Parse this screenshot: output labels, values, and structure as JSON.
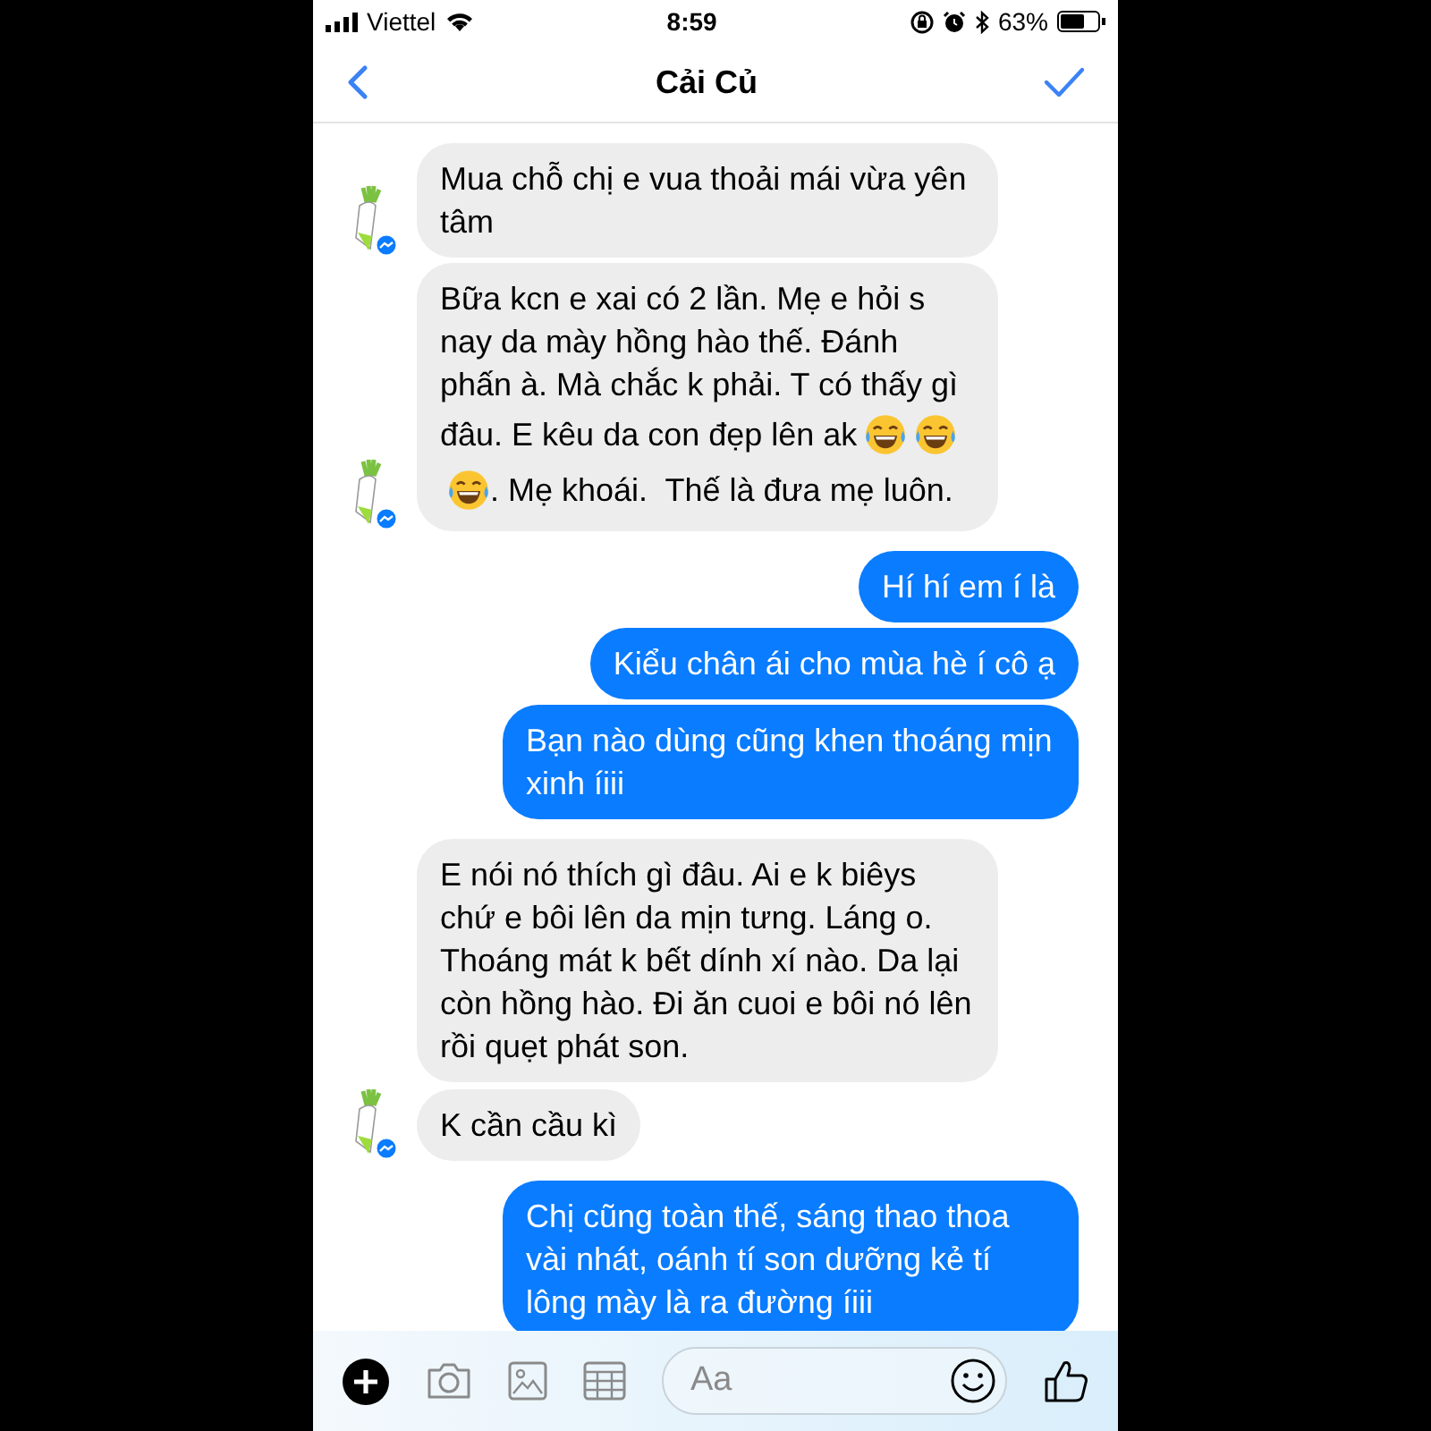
{
  "status_bar": {
    "carrier": "Viettel",
    "time": "8:59",
    "battery": "63%"
  },
  "header": {
    "title": "Cải Củ"
  },
  "messages": [
    {
      "kind": "incoming",
      "show_avatar": true,
      "segments": [
        {
          "kind": "text",
          "text": "Mua chỗ chị e vua thoải mái vừa yên tâm"
        }
      ]
    },
    {
      "kind": "incoming",
      "show_avatar": true,
      "segments": [
        {
          "kind": "text",
          "text": "Bữa kcn e xai có 2 lần. Mẹ e hỏi s nay da mày hồng hào thế. Đánh phấn à. Mà chắc k phải. T có thấy gì"
        },
        {
          "kind": "break"
        },
        {
          "kind": "text",
          "text": "đâu. E kêu da con đẹp lên ak"
        },
        {
          "kind": "emoji"
        },
        {
          "kind": "emoji"
        },
        {
          "kind": "break"
        },
        {
          "kind": "emoji"
        },
        {
          "kind": "text",
          "text": ". Mẹ khoái.  Thế là đưa mẹ luôn."
        }
      ]
    },
    {
      "kind": "outgoing",
      "segments": [
        {
          "kind": "text",
          "text": "Hí hí em í là"
        }
      ]
    },
    {
      "kind": "outgoing",
      "segments": [
        {
          "kind": "text",
          "text": "Kiểu chân ái cho mùa hè í cô ạ"
        }
      ]
    },
    {
      "kind": "outgoing",
      "segments": [
        {
          "kind": "text",
          "text": "Bạn nào dùng cũng khen thoáng mịn xinh íiii"
        }
      ]
    },
    {
      "kind": "incoming",
      "show_avatar": false,
      "segments": [
        {
          "kind": "text",
          "text": "E nói nó thích gì đâu. Ai e k biêys chứ e bôi lên da mịn tưng. Láng o. Thoáng mát k bết dính xí nào. Da lại còn hồng hào. Đi ăn cuoi e bôi nó lên rồi quẹt phát son."
        }
      ]
    },
    {
      "kind": "incoming",
      "show_avatar": true,
      "segments": [
        {
          "kind": "text",
          "text": "K cần cầu kì"
        }
      ]
    },
    {
      "kind": "outgoing",
      "segments": [
        {
          "kind": "text",
          "text": "Chị cũng toàn thế, sáng thao thoa vài nhát, oánh tí son dưỡng kẻ tí lông mày là ra đường íiii"
        }
      ]
    }
  ],
  "composer": {
    "placeholder": "Aa"
  }
}
